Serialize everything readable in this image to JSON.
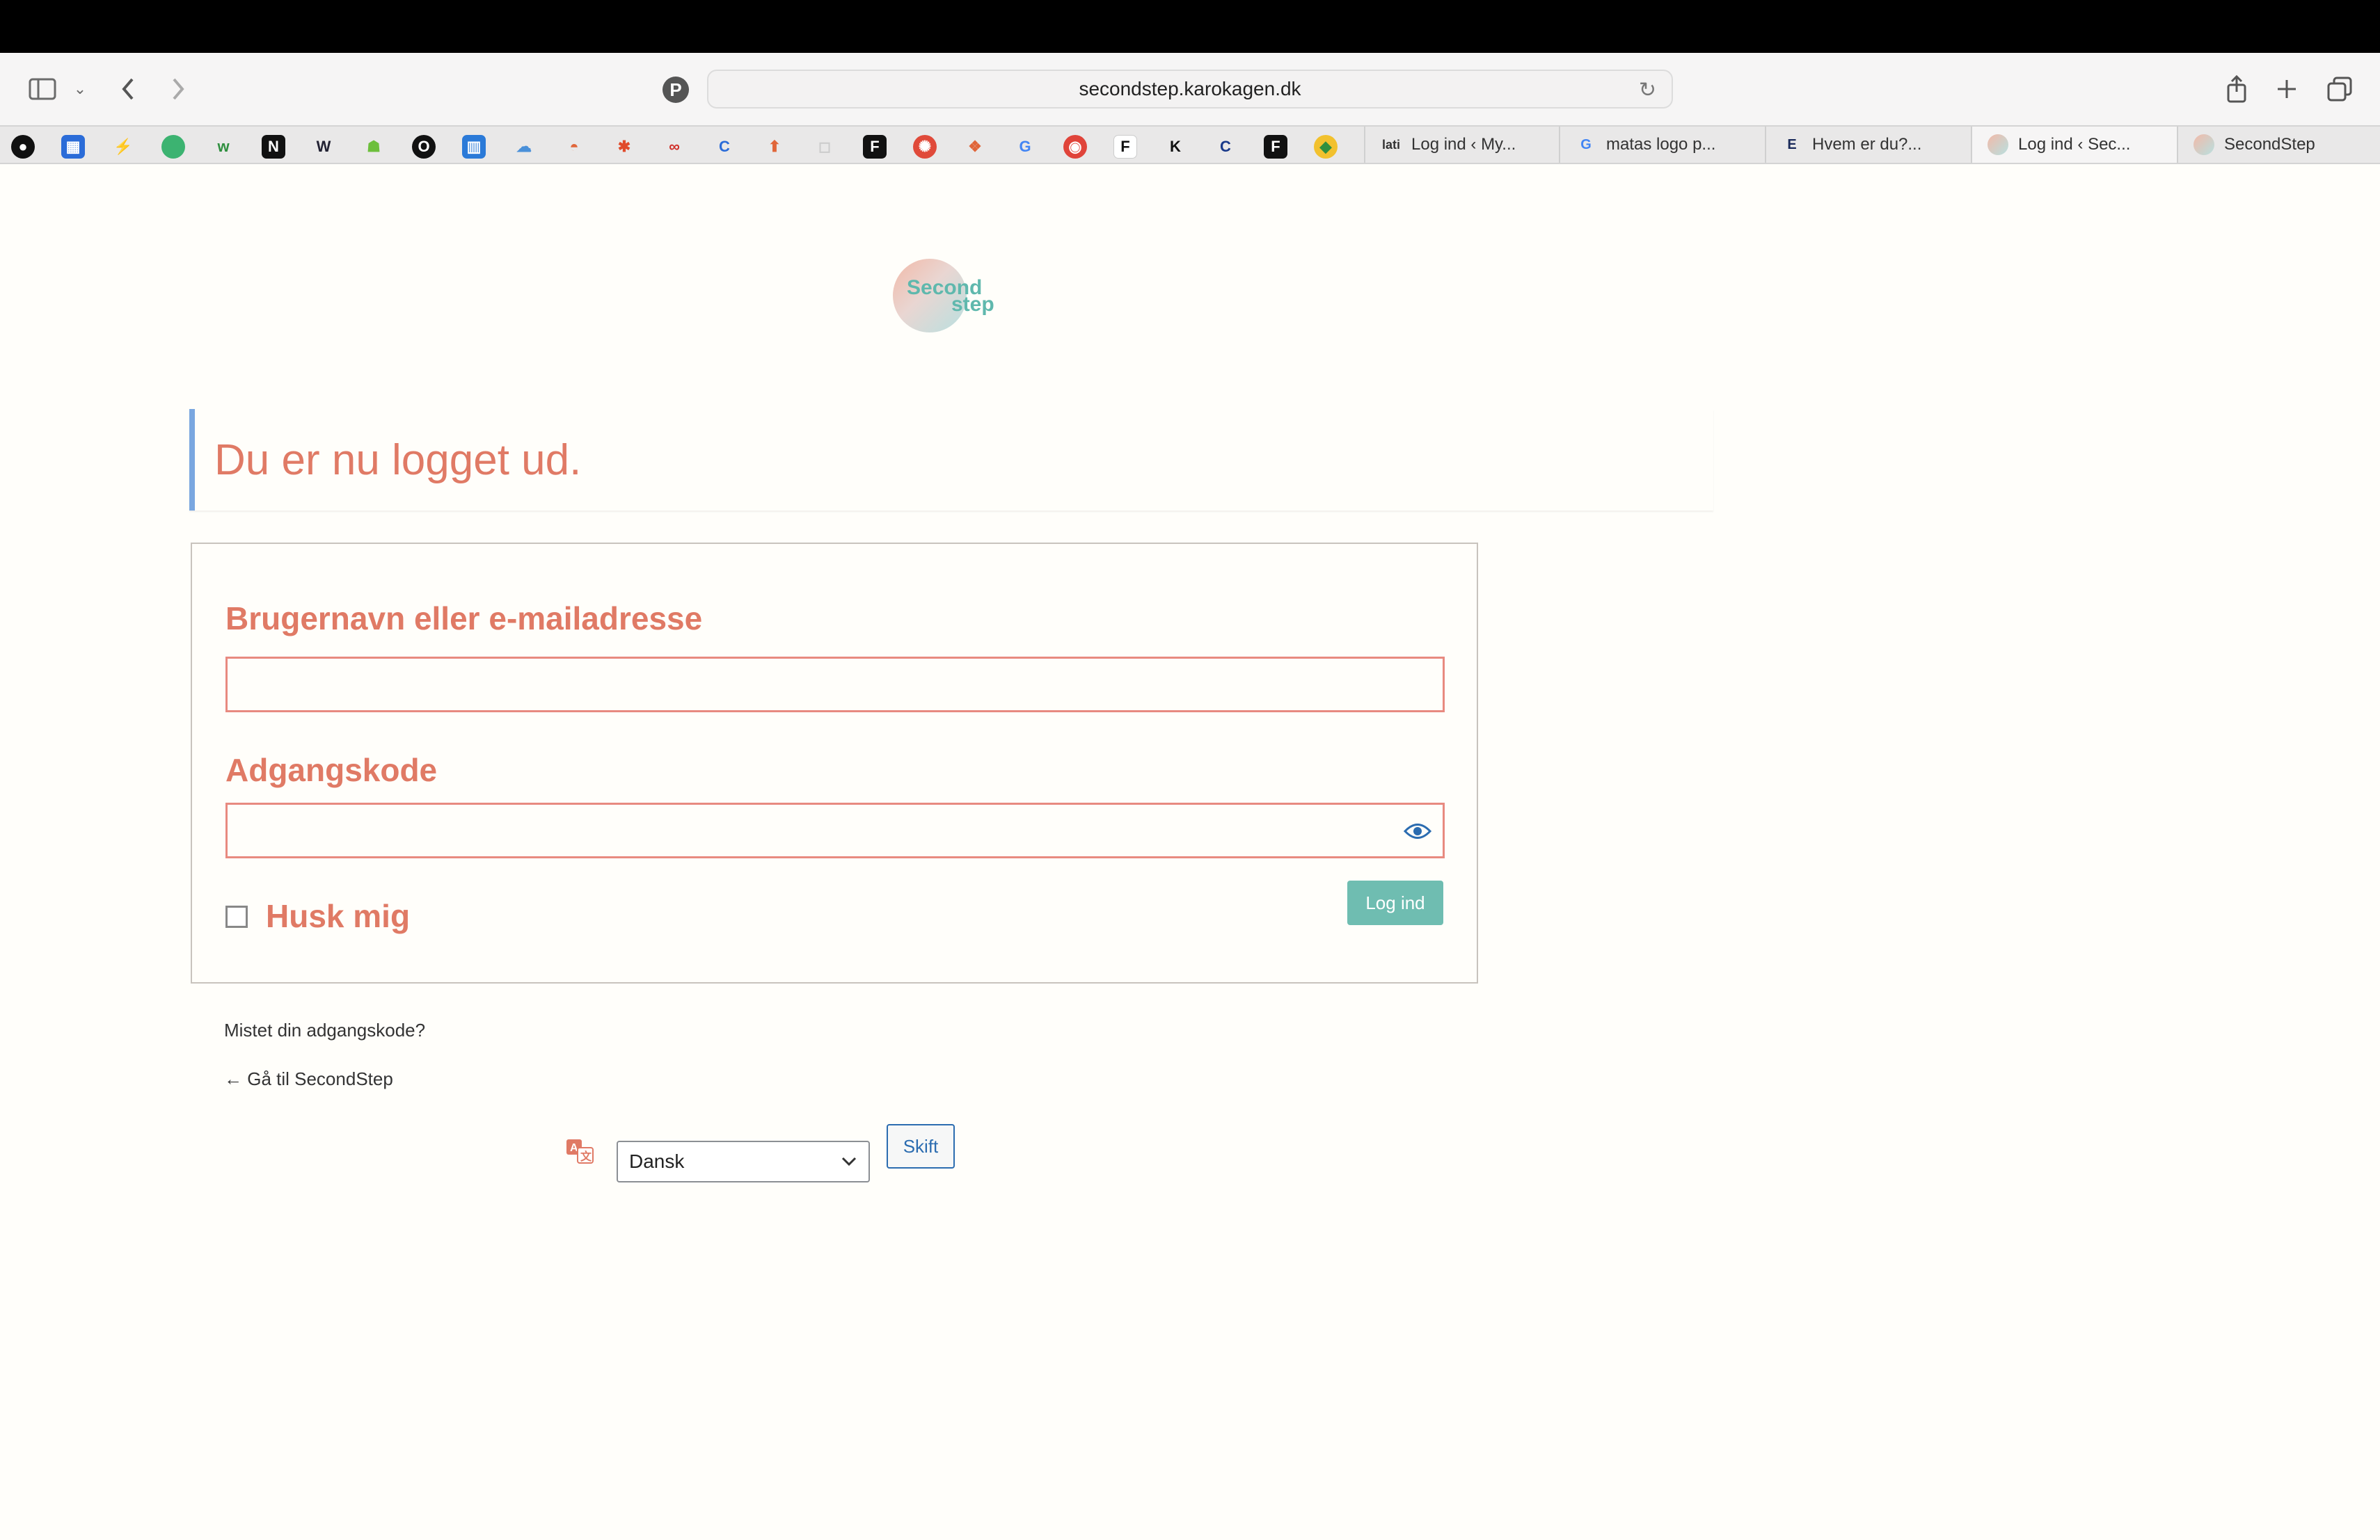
{
  "browser": {
    "url": "secondstep.karokagen.dk",
    "tabs": [
      {
        "label": "Log ind ‹ My..."
      },
      {
        "label": "matas logo p..."
      },
      {
        "label": "Hvem er du?..."
      },
      {
        "label": "Log ind ‹ Sec..."
      },
      {
        "label": "SecondStep"
      }
    ]
  },
  "logo": {
    "line1": "Second",
    "line2": "step"
  },
  "notice": {
    "message": "Du er nu logget ud."
  },
  "login": {
    "username_label": "Brugernavn eller e-mailadresse",
    "username_value": "",
    "password_label": "Adgangskode",
    "password_value": "",
    "remember_label": "Husk mig",
    "submit_label": "Log ind"
  },
  "links": {
    "lost_password": "Mistet din adgangskode?",
    "back_to_site": "← Gå til SecondStep"
  },
  "language": {
    "selected": "Dansk",
    "switch_label": "Skift"
  },
  "colors": {
    "accent": "#e07a65",
    "button": "#6fbdb1",
    "notice_border": "#7aa7e0",
    "link_blue": "#2b6cb0"
  }
}
